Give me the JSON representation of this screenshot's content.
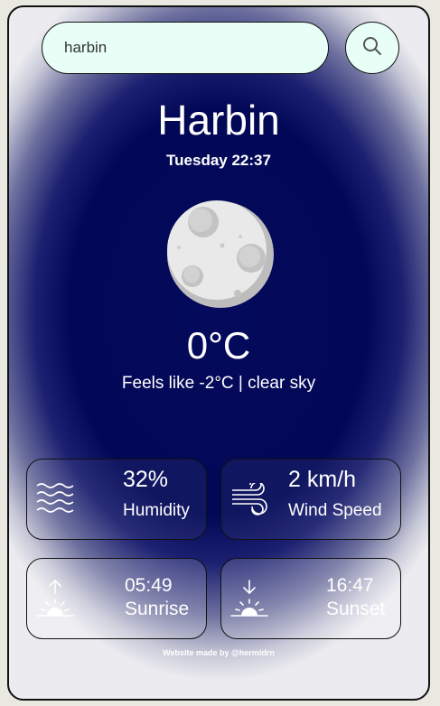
{
  "search": {
    "value": "harbin"
  },
  "location": {
    "city": "Harbin",
    "datetime": "Tuesday 22:37"
  },
  "weather": {
    "icon": "moon-icon",
    "temperature": "0°C",
    "feels": "Feels like -2°C | clear sky"
  },
  "stats": {
    "humidity": {
      "value": "32%",
      "label": "Humidity",
      "icon": "waves-icon"
    },
    "wind": {
      "value": "2 km/h",
      "label": "Wind Speed",
      "icon": "wind-icon"
    },
    "sunrise": {
      "value": "05:49",
      "label": "Sunrise",
      "icon": "sunrise-icon"
    },
    "sunset": {
      "value": "16:47",
      "label": "Sunset",
      "icon": "sunset-icon"
    }
  },
  "footer": {
    "text": "Website made by @hermidrn"
  },
  "colors": {
    "background": "#020856",
    "search_bg": "#e8fff8",
    "text": "#ffffff"
  }
}
